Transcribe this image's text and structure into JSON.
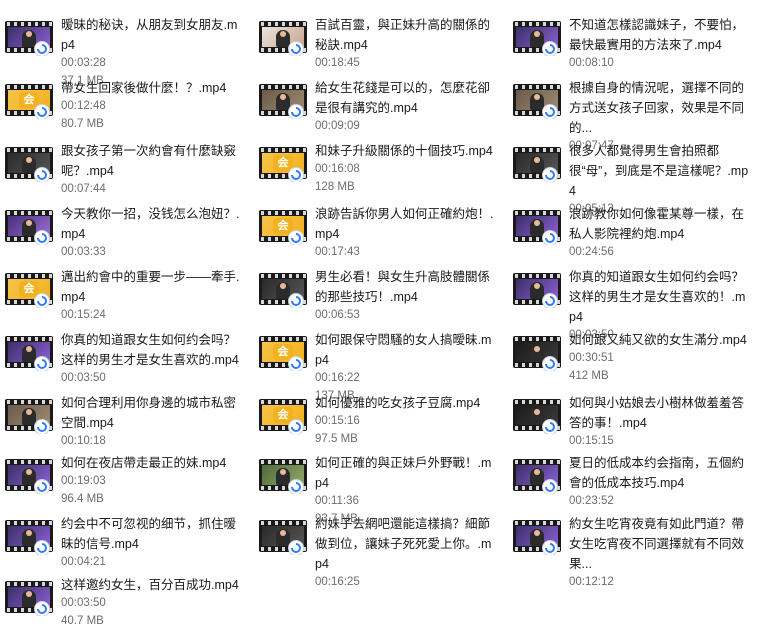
{
  "files": [
    {
      "name": "暧昧的秘诀，从朋友到女朋友.mp4",
      "duration": "00:03:28",
      "size": "37.1 MB",
      "thumb": "studio"
    },
    {
      "name": "百試百靈，與正妹升高的關係的秘訣.mp4",
      "duration": "00:18:45",
      "size": "",
      "thumb": "white"
    },
    {
      "name": "不知道怎樣認識妹子，不要怕，最快最實用的方法來了.mp4",
      "duration": "00:08:10",
      "size": "",
      "thumb": "studio"
    },
    {
      "name": "帶女生回家後做什麼！？.mp4",
      "duration": "00:12:48",
      "size": "80.7 MB",
      "thumb": "logo"
    },
    {
      "name": "給女生花錢是可以的，怎麼花卻是很有講究的.mp4",
      "duration": "00:09:09",
      "size": "",
      "thumb": "street"
    },
    {
      "name": "根據自身的情況呢，選擇不同的方式送女孩子回家，效果是不同的...",
      "duration": "00:07:47",
      "size": "",
      "thumb": "street"
    },
    {
      "name": "跟女孩子第一次約會有什麼缺竅呢？.mp4",
      "duration": "00:07:44",
      "size": "",
      "thumb": "dark"
    },
    {
      "name": "和妹子升級關係的十個技巧.mp4",
      "duration": "00:16:08",
      "size": "128 MB",
      "thumb": "logo"
    },
    {
      "name": "很多人都覺得男生會拍照都很“母”，到底是不是這樣呢？.mp4",
      "duration": "00:05:13",
      "size": "",
      "thumb": "dark"
    },
    {
      "name": "今天教你一招，没钱怎么泡妞？.mp4",
      "duration": "00:03:33",
      "size": "",
      "thumb": "purple"
    },
    {
      "name": "浪跡告訴你男人如何正確約炮！.mp4",
      "duration": "00:17:43",
      "size": "",
      "thumb": "logo"
    },
    {
      "name": "浪跡教你如何像霍某尊一樣，在私人影院裡約炮.mp4",
      "duration": "00:24:56",
      "size": "",
      "thumb": "studio"
    },
    {
      "name": "邁出約會中的重要一步——牽手.mp4",
      "duration": "00:15:24",
      "size": "",
      "thumb": "logo"
    },
    {
      "name": "男生必看！與女生升高肢體關係的那些技巧！.mp4",
      "duration": "00:06:53",
      "size": "",
      "thumb": "dark"
    },
    {
      "name": "你真的知道跟女生如何约会吗？这样的男生才是女生喜欢的！.mp4",
      "duration": "00:03:50",
      "size": "",
      "thumb": "studio"
    },
    {
      "name": "你真的知道跟女生如何约会吗？这样的男生才是女生喜欢的.mp4",
      "duration": "00:03:50",
      "size": "",
      "thumb": "studio"
    },
    {
      "name": "如何跟保守悶騷的女人搞曖昧.mp4",
      "duration": "00:16:22",
      "size": "137 MB",
      "thumb": "logo"
    },
    {
      "name": "如何跟又純又欲的女生滿分.mp4",
      "duration": "00:30:51",
      "size": "412 MB",
      "thumb": "darkroom"
    },
    {
      "name": "如何合理利用你身邊的城市私密空間.mp4",
      "duration": "00:10:18",
      "size": "",
      "thumb": "street"
    },
    {
      "name": "如何優雅的吃女孩子豆腐.mp4",
      "duration": "00:15:16",
      "size": "97.5 MB",
      "thumb": "logo"
    },
    {
      "name": "如何與小姑娘去小樹林做羞羞答答的事！.mp4",
      "duration": "00:15:15",
      "size": "",
      "thumb": "darkroom"
    },
    {
      "name": "如何在夜店帶走最正的妹.mp4",
      "duration": "00:19:03",
      "size": "96.4 MB",
      "thumb": "studio"
    },
    {
      "name": "如何正確的與正妹戶外野戰！.mp4",
      "duration": "00:11:36",
      "size": "93.7 MB",
      "thumb": "green"
    },
    {
      "name": "夏日的低成本约会指南，五個約會的低成本技巧.mp4",
      "duration": "00:23:52",
      "size": "",
      "thumb": "studio"
    },
    {
      "name": "约会中不可忽视的细节，抓住暧昧的信号.mp4",
      "duration": "00:04:21",
      "size": "",
      "thumb": "studio"
    },
    {
      "name": "約妹子去網吧還能這樣搞？細節做到位，讓妹子死死愛上你。.mp4",
      "duration": "00:16:25",
      "size": "",
      "thumb": "dark"
    },
    {
      "name": "約女生吃宵夜竟有如此門道？帶女生吃宵夜不同選擇就有不同效果...",
      "duration": "00:12:12",
      "size": "",
      "thumb": "studio"
    },
    {
      "name": "这样邀约女生，百分百成功.mp4",
      "duration": "00:03:50",
      "size": "40.7 MB",
      "thumb": "studio"
    }
  ],
  "thumb_styles": {
    "studio": {
      "bg": "#3b2f6b",
      "accent": "#8a5fd1"
    },
    "white": {
      "bg": "#e9e4df",
      "accent": "#c9a48c"
    },
    "street": {
      "bg": "#6b5a4a",
      "accent": "#9c8a70"
    },
    "dark": {
      "bg": "#2a2a2a",
      "accent": "#555555"
    },
    "purple": {
      "bg": "#4a2e7a",
      "accent": "#9b6dd6"
    },
    "darkroom": {
      "bg": "#1b1b1b",
      "accent": "#3a3a3a"
    },
    "green": {
      "bg": "#4f6b3a",
      "accent": "#8fa86a"
    },
    "logo": {
      "bg": "#f6c34a",
      "accent": "#f2b21f"
    }
  },
  "logo_glyph": "会"
}
